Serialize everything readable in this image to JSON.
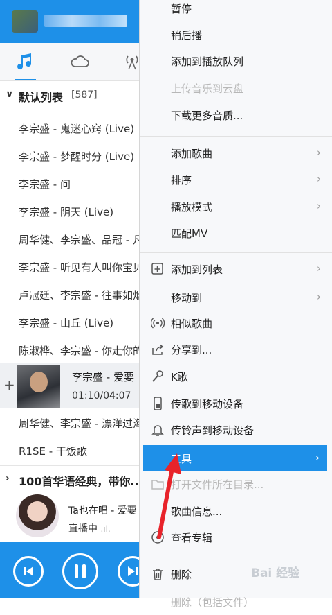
{
  "tabs": {
    "music_icon": "music-note-icon",
    "cloud_icon": "cloud-icon",
    "radio_icon": "radio-icon"
  },
  "groups": [
    {
      "label": "默认列表",
      "count": "[587]"
    },
    {
      "label": "100首华语经典，带你..."
    }
  ],
  "songs": [
    "李宗盛 - 鬼迷心窍 (Live)",
    "李宗盛 - 梦醒时分 (Live)",
    "李宗盛 - 问",
    "李宗盛 - 阴天 (Live)",
    "周华健、李宗盛、品冠 - 凡人歌",
    "李宗盛 - 听见有人叫你宝贝",
    "卢冠廷、李宗盛 - 往事如烟",
    "李宗盛 - 山丘 (Live)",
    "陈淑桦、李宗盛 - 你走你的路",
    "周华健、李宗盛 - 漂洋过海来看你",
    "R1SE - 干饭歌"
  ],
  "now_playing": {
    "title": "李宗盛 - 爱要",
    "time": "01:10/04:07"
  },
  "live": {
    "title": "Ta也在唱 - 爱要",
    "status": "直播中"
  },
  "menu": {
    "items": [
      {
        "label": "暂停"
      },
      {
        "label": "稍后播"
      },
      {
        "label": "添加到播放队列"
      },
      {
        "label": "上传音乐到云盘",
        "disabled": true
      },
      {
        "label": "下载更多音质..."
      },
      {
        "label": "添加歌曲"
      },
      {
        "label": "排序"
      },
      {
        "label": "播放模式"
      },
      {
        "label": "匹配MV"
      },
      {
        "label": "添加到列表"
      },
      {
        "label": "移动到"
      },
      {
        "label": "相似歌曲"
      },
      {
        "label": "分享到..."
      },
      {
        "label": "K歌"
      },
      {
        "label": "传歌到移动设备"
      },
      {
        "label": "传铃声到移动设备"
      },
      {
        "label": "工具"
      },
      {
        "label": "打开文件所在目录..."
      },
      {
        "label": "歌曲信息..."
      },
      {
        "label": "查看专辑"
      },
      {
        "label": "删除"
      },
      {
        "label": "删除（包括文件）"
      }
    ]
  },
  "watermark": "Bai 经验",
  "colors": {
    "accent": "#1e90e8",
    "highlight": "#1e90e8",
    "arrow": "#e8232a"
  }
}
